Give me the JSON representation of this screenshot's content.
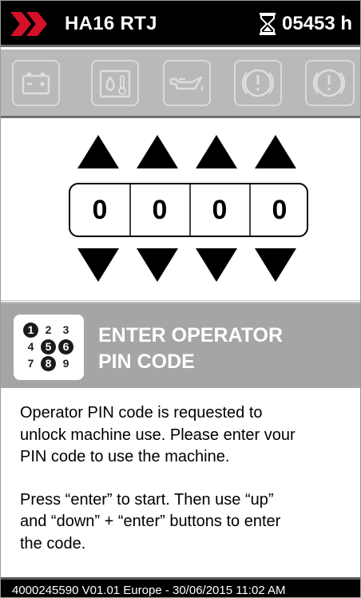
{
  "status_bar": {
    "model": "HA16 RTJ",
    "hour_meter": "05453 h",
    "logo_icon": "chevron-logo-icon",
    "hours_icon": "hourglass-icon",
    "brand_color": "#d7102a"
  },
  "toolbar": {
    "icons": [
      "battery-icon",
      "fuel-temperature-icon",
      "engine-oil-icon",
      "warning-icon",
      "warning-icon"
    ]
  },
  "pin_entry": {
    "digits": [
      "0",
      "0",
      "0",
      "0"
    ],
    "up_icon": "triangle-up-icon",
    "down_icon": "triangle-down-icon"
  },
  "header": {
    "icon": "keypad-icon",
    "keypad": [
      "1",
      "2",
      "3",
      "4",
      "5",
      "6",
      "7",
      "8",
      "9"
    ],
    "title_line1": "ENTER OPERATOR",
    "title_line2": "PIN CODE"
  },
  "body": {
    "paragraph1_lines": [
      "Operator PIN code is requested to",
      "unlock machine use. Please enter vour",
      "PIN code to use the machine."
    ],
    "paragraph2_lines": [
      "Press “enter” to start. Then use “up”",
      "and “down” + “enter” buttons to enter",
      "the code."
    ]
  },
  "footer": {
    "text": "4000245590 V01.01 Europe - 30/06/2015 11:02 AM"
  }
}
